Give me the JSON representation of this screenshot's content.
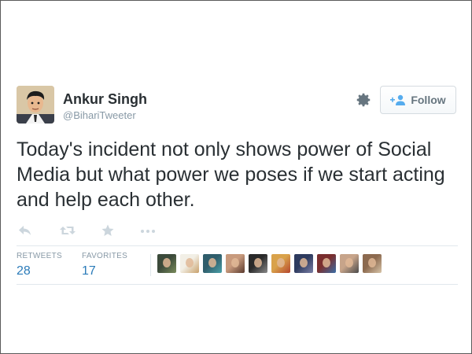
{
  "tweet": {
    "author": {
      "name": "Ankur Singh",
      "handle": "@BihariTweeter",
      "avatar_icon": "cartoon-man-avatar"
    },
    "text": "Today's incident not only shows power of Social Media but what power we poses if we start acting and help each other.",
    "follow_label": "Follow",
    "settings_icon": "gear-icon",
    "actions": [
      "reply-icon",
      "retweet-icon",
      "favorite-icon",
      "more-icon"
    ],
    "stats": {
      "retweets_label": "RETWEETS",
      "retweets_count": "28",
      "favorites_label": "FAVORITES",
      "favorites_count": "17"
    },
    "favoriters": [
      {
        "name": "favoriter-avatar",
        "colors": [
          "#3b4a3a",
          "#7a8b5c"
        ]
      },
      {
        "name": "favoriter-avatar",
        "colors": [
          "#f2efe6",
          "#c8a06a"
        ]
      },
      {
        "name": "favoriter-avatar",
        "colors": [
          "#2f5d6b",
          "#4aa0a8"
        ]
      },
      {
        "name": "favoriter-avatar",
        "colors": [
          "#c89a7d",
          "#5a3a2e"
        ]
      },
      {
        "name": "favoriter-avatar",
        "colors": [
          "#2a2a2a",
          "#8a8a8a"
        ]
      },
      {
        "name": "favoriter-avatar",
        "colors": [
          "#d9a24a",
          "#b5462e"
        ]
      },
      {
        "name": "favoriter-avatar",
        "colors": [
          "#2d3a5e",
          "#7b7fa6"
        ]
      },
      {
        "name": "favoriter-avatar",
        "colors": [
          "#7a2e2e",
          "#3a6fa8"
        ]
      },
      {
        "name": "favoriter-avatar",
        "colors": [
          "#c7a48a",
          "#4a4a4a"
        ]
      },
      {
        "name": "favoriter-avatar",
        "colors": [
          "#8c6a4f",
          "#d7c4a8"
        ]
      }
    ],
    "colors": {
      "text": "#292f33",
      "muted": "#8899a6",
      "link": "#2b7bb9",
      "border": "#e1e8ed",
      "icon": "#ccd6dd",
      "follow_accent": "#55acee"
    }
  }
}
